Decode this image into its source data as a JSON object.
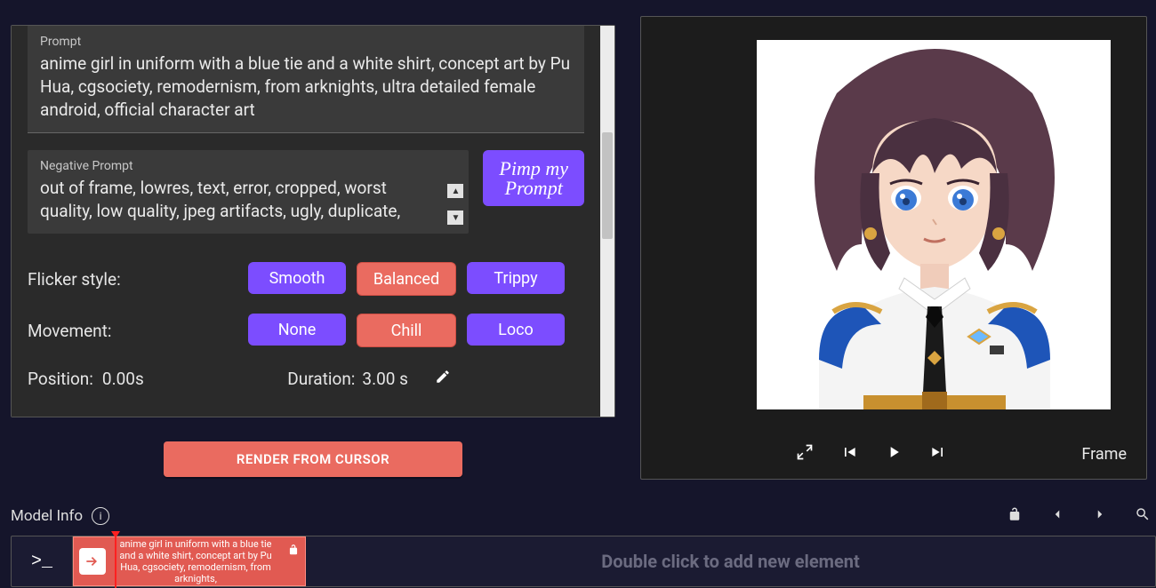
{
  "prompt": {
    "label": "Prompt",
    "text": "anime girl in uniform with a blue tie and a white shirt, concept art by Pu Hua, cgsociety, remodernism, from arknights, ultra detailed female android, official character art"
  },
  "negative_prompt": {
    "label": "Negative Prompt",
    "text": "out of frame, lowres, text, error, cropped, worst quality, low quality, jpeg artifacts, ugly, duplicate,"
  },
  "pimp_button": "Pimp my Prompt",
  "flicker": {
    "label": "Flicker style:",
    "options": [
      "Smooth",
      "Balanced",
      "Trippy"
    ],
    "selected": "Balanced"
  },
  "movement": {
    "label": "Movement:",
    "options": [
      "None",
      "Chill",
      "Loco"
    ],
    "selected": "Chill"
  },
  "position": {
    "label": "Position:",
    "value": "0.00s"
  },
  "duration": {
    "label": "Duration:",
    "value": "3.00 s"
  },
  "render_button": "RENDER FROM CURSOR",
  "preview": {
    "frame_label": "Frame"
  },
  "model_info": {
    "label": "Model Info"
  },
  "timeline": {
    "terminal_prompt": ">_",
    "clip_text": "anime girl in uniform with a blue tie and a white shirt, concept art by Pu Hua, cgsociety, remodernism, from arknights,",
    "hint": "Double click to add new element"
  }
}
